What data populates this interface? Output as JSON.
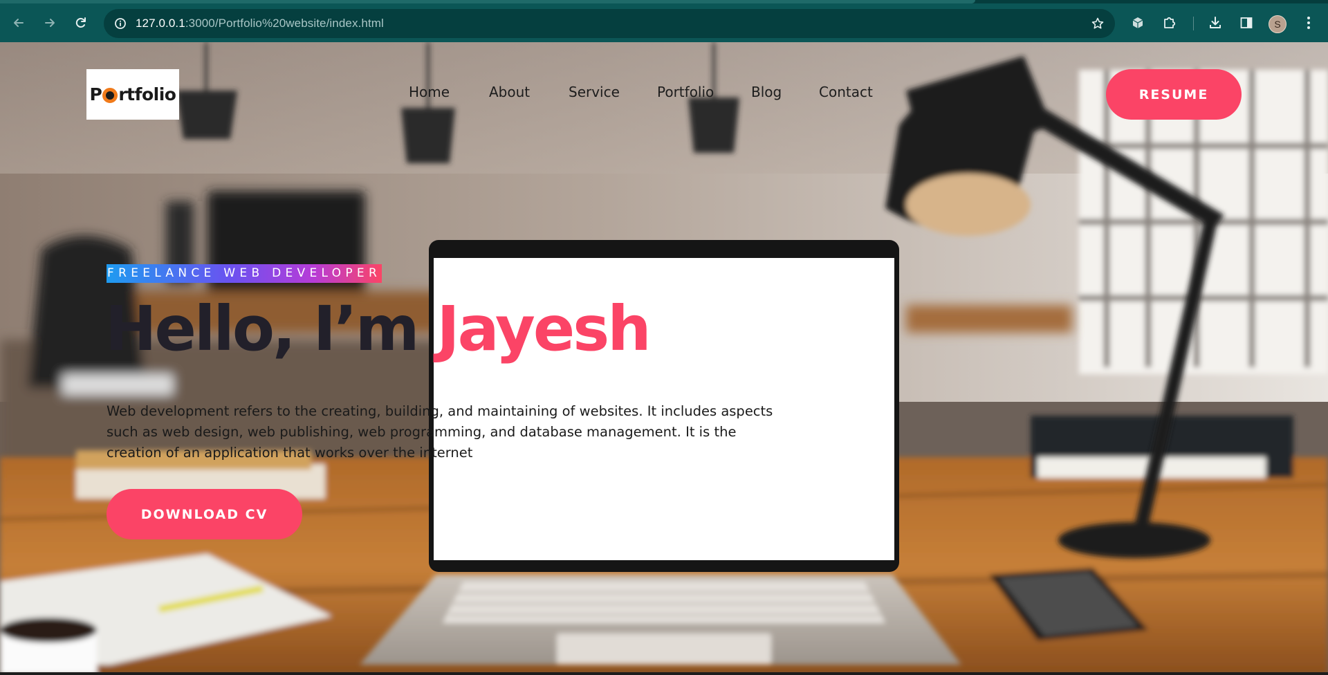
{
  "browser": {
    "url_host": "127.0.0.1",
    "url_path": ":3000/Portfolio%20website/index.html",
    "profile_initial": "S",
    "icons": {
      "back": "arrow-left-icon",
      "forward": "arrow-right-icon",
      "reload": "reload-icon",
      "site_info": "info-icon",
      "bookmark": "star-icon",
      "extension_cube": "cube-icon",
      "extensions": "puzzle-icon",
      "downloads": "download-icon",
      "side_panel": "side-panel-icon",
      "menu": "kebab-menu-icon"
    }
  },
  "header": {
    "logo_text_before": "P",
    "logo_text_after": "rtfolio",
    "nav": [
      {
        "label": "Home"
      },
      {
        "label": "About"
      },
      {
        "label": "Service"
      },
      {
        "label": "Portfolio"
      },
      {
        "label": "Blog"
      },
      {
        "label": "Contact"
      }
    ],
    "resume_label": "RESUME"
  },
  "hero": {
    "tagline": "FREELANCE WEB DEVELOPER",
    "title_prefix": "Hello, I’m ",
    "title_name": "Jayesh",
    "description": "Web development refers to the creating, building, and maintaining of websites. It includes aspects such as web design, web publishing, web programming, and database management. It is the creation of an application that works over the internet",
    "cta_label": "DOWNLOAD CV"
  },
  "colors": {
    "accent": "#fb4466",
    "chrome": "#0b5656",
    "omnibox": "#053f3f",
    "title_dark": "#22202a"
  }
}
